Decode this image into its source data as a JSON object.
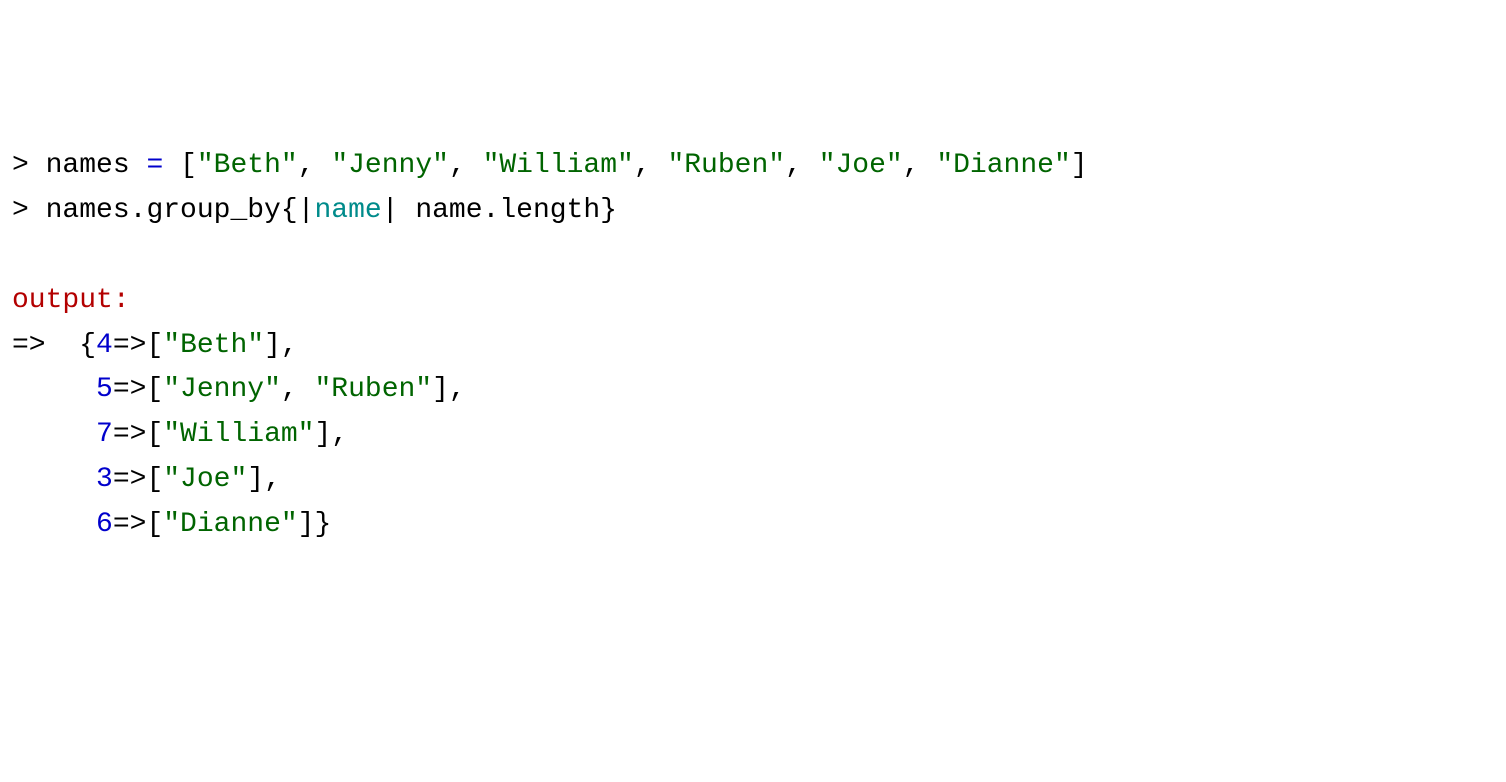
{
  "line1": {
    "prompt": "> ",
    "var": "names",
    "sp1": " ",
    "op": "=",
    "sp2": " ",
    "lb": "[",
    "s1": "\"Beth\"",
    "c1": ",",
    "sp3": " ",
    "s2": "\"Jenny\"",
    "c2": ",",
    "sp4": " ",
    "s3": "\"William\"",
    "c3": ",",
    "sp5": " ",
    "s4": "\"Ruben\"",
    "c4": ",",
    "sp6": " ",
    "s5": "\"Joe\"",
    "c5": ",",
    "sp7": " ",
    "s6": "\"Dianne\"",
    "rb": "]"
  },
  "line2": {
    "prompt": "> ",
    "var": "names",
    "dot": ".",
    "method": "group_by",
    "lbrace": "{",
    "pipe1": "|",
    "param": "name",
    "pipe2": "|",
    "sp": " ",
    "expr": "name.length",
    "rbrace": "}"
  },
  "blank": " ",
  "outputLabel": "output:",
  "result": {
    "arrow": "=>  ",
    "lbrace": "{",
    "rows": [
      {
        "indent": "",
        "key": "4",
        "op": "=>",
        "lb": "[",
        "vals": [
          "\"Beth\""
        ],
        "rb": "]",
        "trail": ","
      },
      {
        "indent": "     ",
        "key": "5",
        "op": "=>",
        "lb": "[",
        "vals": [
          "\"Jenny\"",
          "\"Ruben\""
        ],
        "rb": "]",
        "trail": ","
      },
      {
        "indent": "     ",
        "key": "7",
        "op": "=>",
        "lb": "[",
        "vals": [
          "\"William\""
        ],
        "rb": "]",
        "trail": ","
      },
      {
        "indent": "     ",
        "key": "3",
        "op": "=>",
        "lb": "[",
        "vals": [
          "\"Joe\""
        ],
        "rb": "]",
        "trail": ","
      },
      {
        "indent": "     ",
        "key": "6",
        "op": "=>",
        "lb": "[",
        "vals": [
          "\"Dianne\""
        ],
        "rb": "]",
        "trail": "}"
      }
    ]
  }
}
